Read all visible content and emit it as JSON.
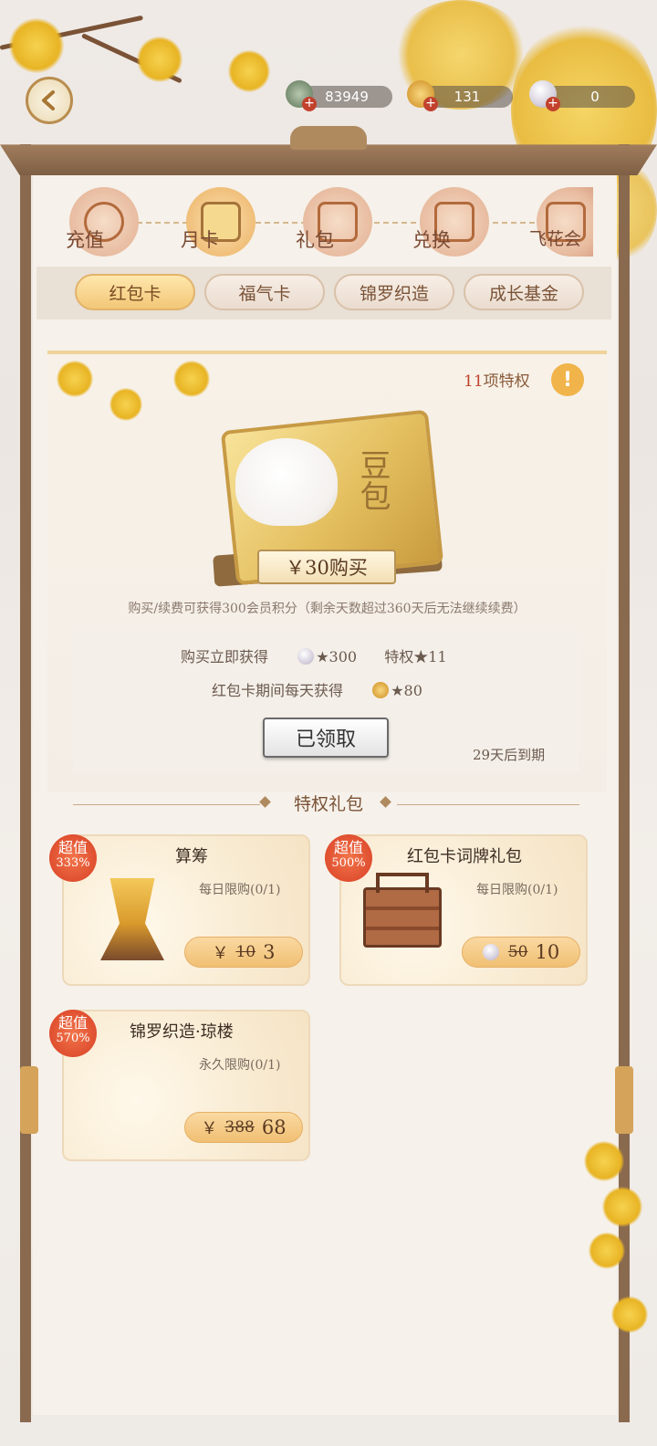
{
  "resources": [
    {
      "icon": "jade-coin-icon",
      "value": "83949"
    },
    {
      "icon": "gold-ingot-icon",
      "value": "131"
    },
    {
      "icon": "pearl-icon",
      "value": "0"
    }
  ],
  "categories": [
    {
      "label": "充值",
      "icon": "recharge-icon"
    },
    {
      "label": "月卡",
      "icon": "month-card-icon"
    },
    {
      "label": "礼包",
      "icon": "gift-pack-icon"
    },
    {
      "label": "兑换",
      "icon": "exchange-icon"
    },
    {
      "label": "飞花会",
      "icon": "feihua-icon"
    }
  ],
  "tabs": [
    "红包卡",
    "福气卡",
    "锦罗织造",
    "成长基金"
  ],
  "card": {
    "privilege_count": "11",
    "privilege_suffix": "项特权",
    "card_text": "豆包",
    "buy_label": "￥30购买",
    "note": "购买/续费可获得300会员积分（剩余天数超过360天后无法继续续费）",
    "immediate_label": "购买立即获得",
    "immediate_amount": "★300",
    "privilege_label": "特权★11",
    "daily_label": "红包卡期间每天获得",
    "daily_amount": "★80",
    "claimed_label": "已领取",
    "expire_text": "29天后到期"
  },
  "section_title": "特权礼包",
  "gifts": [
    {
      "badge_top": "超值",
      "badge_pct": "333%",
      "title": "算筹",
      "limit": "每日限购(0/1)",
      "currency": "￥",
      "old_price": "10",
      "new_price": "3",
      "icon": "counting-rods-icon"
    },
    {
      "badge_top": "超值",
      "badge_pct": "500%",
      "title": "红包卡词牌礼包",
      "limit": "每日限购(0/1)",
      "currency": "",
      "old_price": "50",
      "new_price": "10",
      "icon": "food-box-icon"
    },
    {
      "badge_top": "超值",
      "badge_pct": "570%",
      "title": "锦罗织造·琼楼",
      "limit": "永久限购(0/1)",
      "currency": "￥",
      "old_price": "388",
      "new_price": "68",
      "icon": "silk-icon"
    }
  ],
  "colors": {
    "accent": "#f0bf72",
    "badge": "#dd4a2c",
    "frame": "#8a6a4e"
  }
}
